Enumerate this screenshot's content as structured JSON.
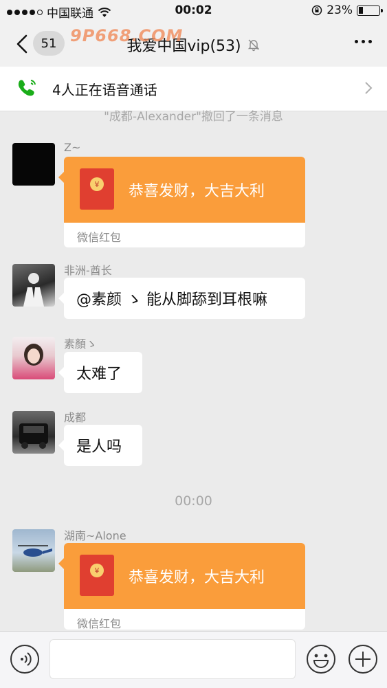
{
  "status_bar": {
    "carrier": "中国联通",
    "time": "00:02",
    "battery": "23%",
    "battery_level": 0.23
  },
  "nav": {
    "back_count": "51",
    "title": "我爱中国vip(53)",
    "watermark": "9P668.COM"
  },
  "voice_call": {
    "text": "4人正在语音通话"
  },
  "system_notice": "\"成都-Alexander\"撤回了一条消息",
  "messages": [
    {
      "sender": "Z~",
      "type": "red_packet",
      "title": "恭喜发财，大吉大利",
      "label": "微信红包"
    },
    {
      "sender": "非洲-酋长",
      "type": "text",
      "text": "@素颜 ゝ 能从脚舔到耳根嘛"
    },
    {
      "sender": "素顏ゝ",
      "type": "text",
      "text": "太难了"
    },
    {
      "sender": "成都",
      "type": "text",
      "text": "是人吗"
    },
    {
      "sender": "湖南~Alone",
      "type": "red_packet",
      "title": "恭喜发财，大吉大利",
      "label": "微信红包"
    }
  ],
  "time_separator": "00:00",
  "colors": {
    "accent_green": "#1aad19",
    "red_packet_orange": "#fa9d3b",
    "red_envelope": "#e03f30"
  }
}
